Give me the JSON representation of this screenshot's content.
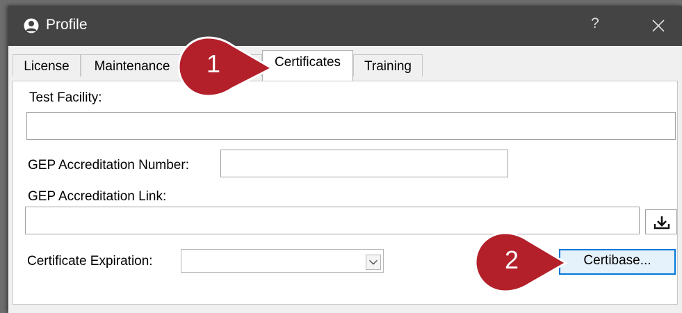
{
  "window": {
    "title": "Profile",
    "help_label": "?"
  },
  "tabs": [
    {
      "label": "License"
    },
    {
      "label": "Maintenance"
    },
    {
      "label": "Certificates"
    },
    {
      "label": "Training"
    }
  ],
  "active_tab": "Certificates",
  "form": {
    "test_facility_label": "Test Facility:",
    "test_facility_value": "",
    "gep_number_label": "GEP Accreditation Number:",
    "gep_number_value": "",
    "gep_link_label": "GEP Accreditation Link:",
    "gep_link_value": "",
    "cert_expiration_label": "Certificate Expiration:",
    "cert_expiration_value": "",
    "certibase_button_label": "Certibase..."
  },
  "callouts": [
    {
      "number": "1"
    },
    {
      "number": "2"
    }
  ],
  "icons": {
    "title": "user-icon",
    "close": "close-icon",
    "download": "download-icon",
    "dropdown": "chevron-down-icon"
  },
  "colors": {
    "titlebar": "#444444",
    "callout": "#b3202a",
    "focus_border": "#0078d7"
  }
}
